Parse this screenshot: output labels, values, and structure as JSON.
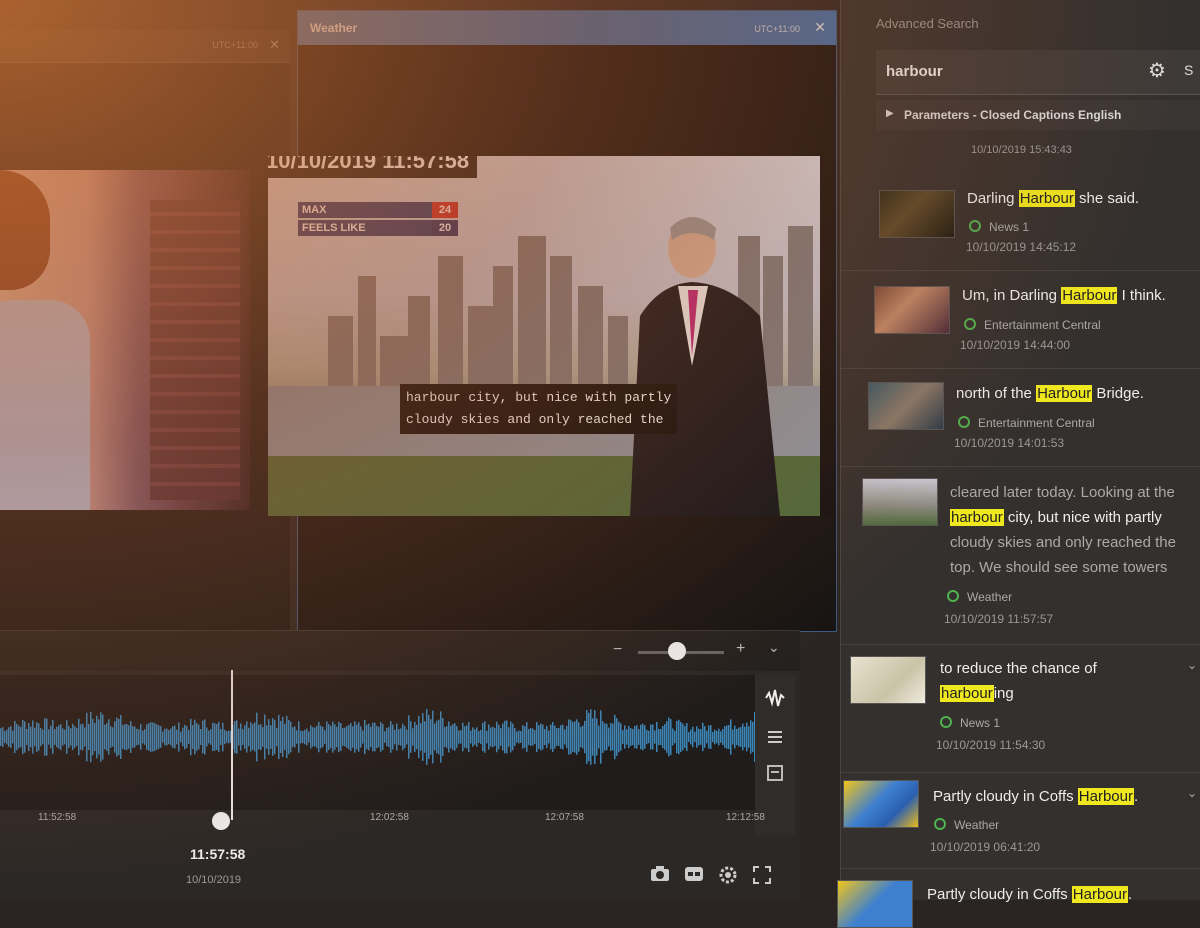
{
  "left_panel": {
    "timezone": "UTC+11:00",
    "close": "✕"
  },
  "weather_panel": {
    "title": "Weather",
    "timezone": "UTC+11:00",
    "close": "✕",
    "video": {
      "datetime": "10/10/2019 11:57:58",
      "temps": [
        {
          "label": "MAX",
          "value": "24"
        },
        {
          "label": "FEELS LIKE",
          "value": "20"
        }
      ],
      "caption_lines": [
        "harbour city, but nice with partly",
        "cloudy skies and only reached the"
      ]
    }
  },
  "timeline": {
    "zoom_minus": "−",
    "zoom_plus": "+",
    "zoom_chevron": "⌄",
    "zoom_level": 0.45,
    "ticks": [
      "11:52:58",
      "12:02:58",
      "12:07:58",
      "12:12:58"
    ],
    "current_time": "11:57:58",
    "current_date": "10/10/2019"
  },
  "search": {
    "title": "Advanced Search",
    "query": "harbour",
    "search_btn": "S",
    "params_label": "Parameters - Closed Captions English",
    "previous_timestamp": "10/10/2019 15:43:43",
    "results": [
      {
        "before": "Darling ",
        "highlight": "Harbour",
        "after": " she said.",
        "source": "News 1",
        "time": "10/10/2019 14:45:12"
      },
      {
        "before": "Um, in Darling ",
        "highlight": "Harbour",
        "after": " I think.",
        "source": "Entertainment Central",
        "time": "10/10/2019 14:44:00"
      },
      {
        "before": "north of the ",
        "highlight": "Harbour",
        "after": " Bridge.",
        "source": "Entertainment Central",
        "time": "10/10/2019 14:01:53"
      },
      {
        "line1": "cleared later today. Looking at the",
        "highlight": "harbour",
        "line2_after": " city, but nice with partly",
        "line3": "cloudy skies and only reached the",
        "line4": "top. We should see some towers",
        "source": "Weather",
        "time": "10/10/2019 11:57:57"
      },
      {
        "line1": "to reduce the chance of",
        "highlight": "harbour",
        "after": "ing",
        "source": "News 1",
        "time": "10/10/2019 11:54:30"
      },
      {
        "before": "Partly cloudy in Coffs ",
        "highlight": "Harbour",
        "after": ".",
        "source": "Weather",
        "time": "10/10/2019 06:41:20"
      },
      {
        "before": "Partly cloudy in Coffs ",
        "highlight": "Harbour",
        "after": "."
      }
    ]
  }
}
